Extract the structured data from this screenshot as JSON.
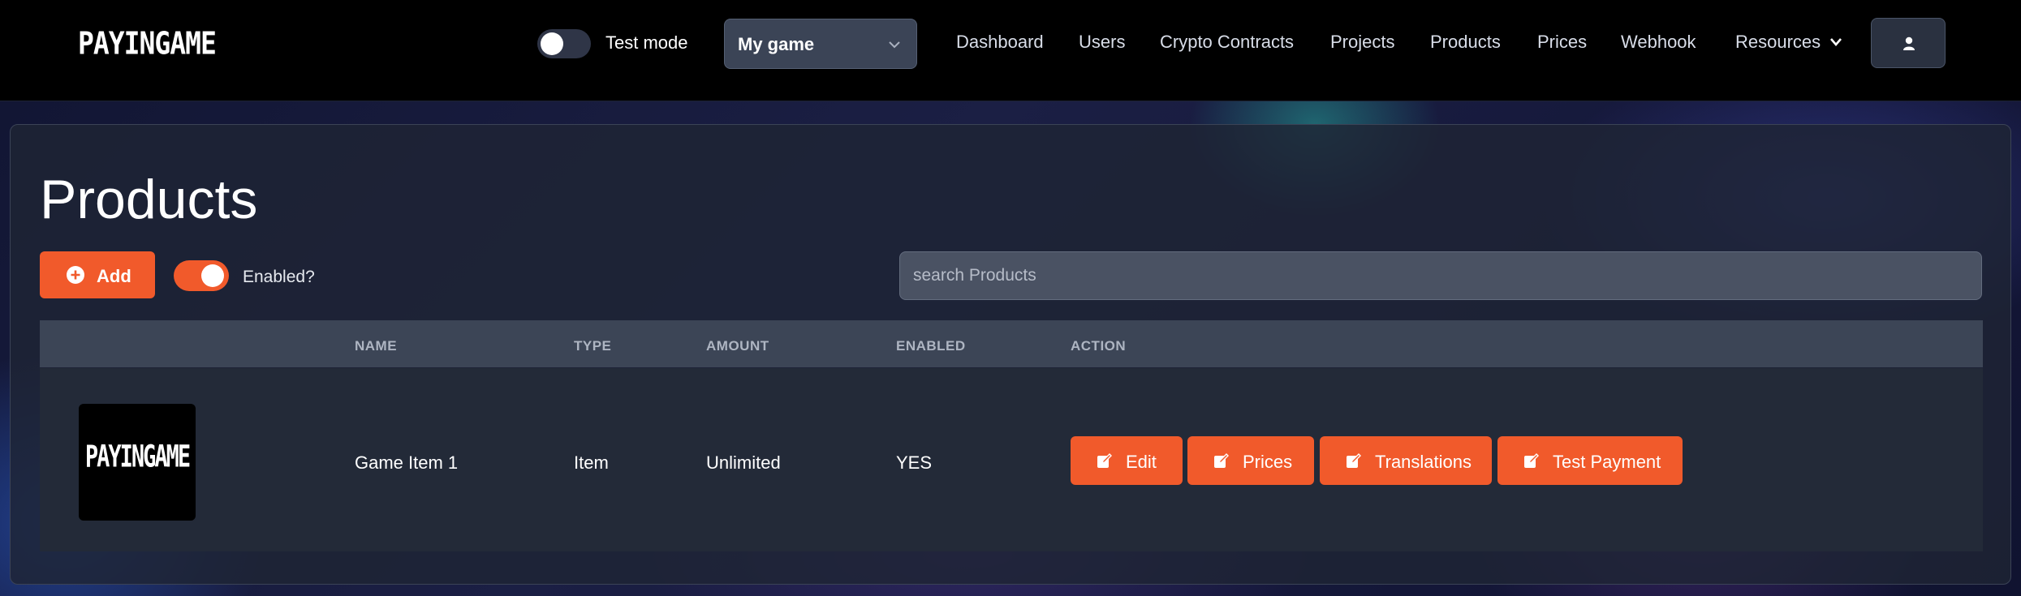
{
  "header": {
    "logo": "PAYINGAME",
    "test_mode_label": "Test mode",
    "test_mode_on": false,
    "game_select": "My game",
    "nav": [
      "Dashboard",
      "Users",
      "Crypto Contracts",
      "Projects",
      "Products",
      "Prices",
      "Webhook",
      "Resources"
    ],
    "user_icon": "user-icon"
  },
  "page": {
    "title": "Products",
    "add_label": "Add",
    "enabled_label": "Enabled?",
    "enabled_on": true,
    "search_placeholder": "search Products"
  },
  "table": {
    "columns": [
      "NAME",
      "TYPE",
      "AMOUNT",
      "ENABLED",
      "ACTION"
    ],
    "rows": [
      {
        "thumbnail": "PAYINGAME",
        "name": "Game Item 1",
        "type": "Item",
        "amount": "Unlimited",
        "enabled": "YES",
        "actions": [
          "Edit",
          "Prices",
          "Translations",
          "Test Payment"
        ]
      }
    ]
  },
  "colors": {
    "accent": "#f15a2b",
    "header_bg": "#000000",
    "panel_bg": "#1e2434"
  }
}
